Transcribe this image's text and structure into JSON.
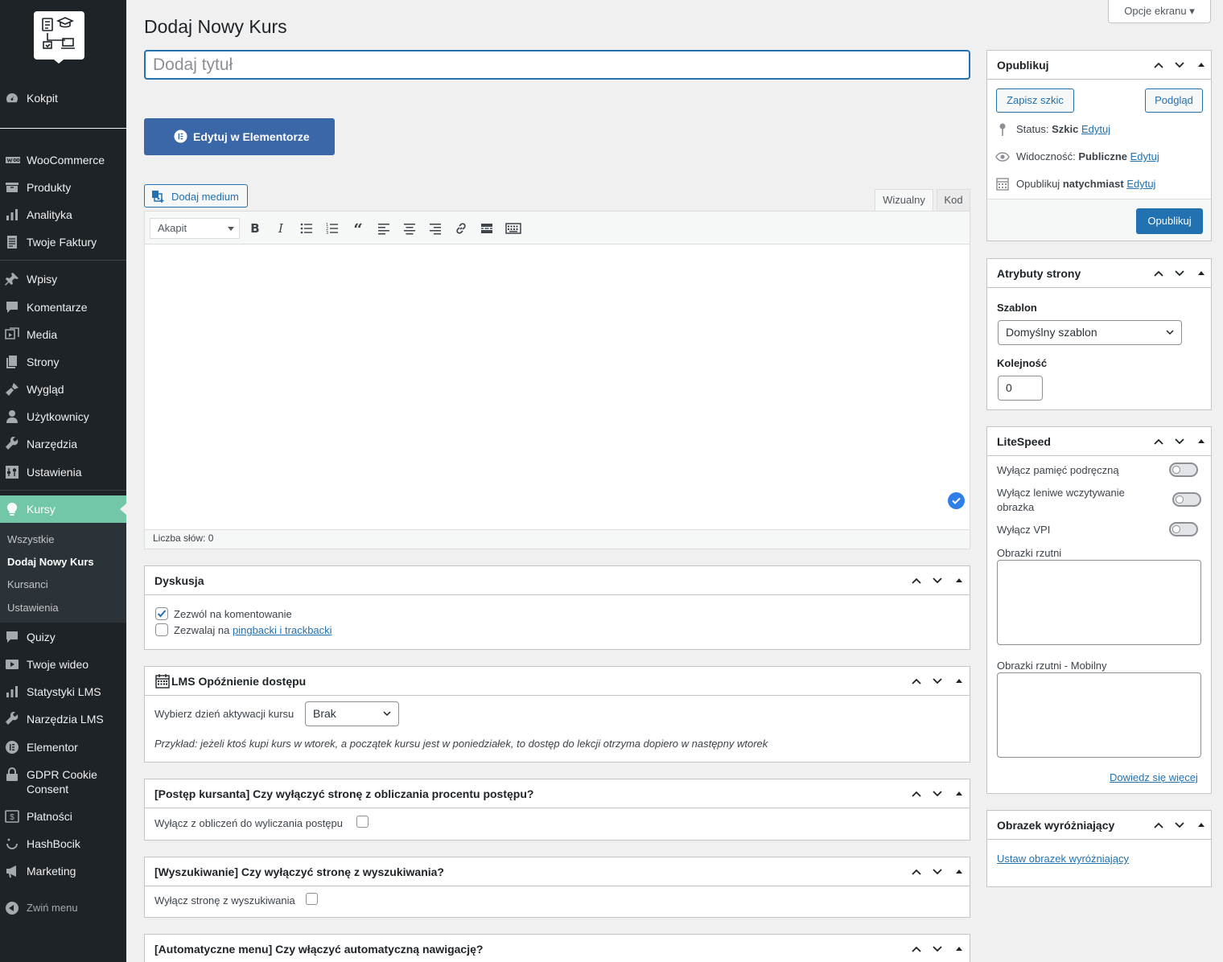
{
  "app": {
    "page_title": "Dodaj Nowy Kurs",
    "screen_options": "Opcje ekranu ▾",
    "title_placeholder": "Dodaj tytuł"
  },
  "sidebar": {
    "items": [
      {
        "label": "Kokpit",
        "icon": "dashboard-icon"
      },
      {
        "label": "WooCommerce",
        "icon": "woocommerce-icon"
      },
      {
        "label": "Produkty",
        "icon": "products-icon"
      },
      {
        "label": "Analityka",
        "icon": "analytics-icon"
      },
      {
        "label": "Twoje Faktury",
        "icon": "invoices-icon"
      },
      {
        "label": "Wpisy",
        "icon": "pin-icon"
      },
      {
        "label": "Komentarze",
        "icon": "comments-icon"
      },
      {
        "label": "Media",
        "icon": "media-icon"
      },
      {
        "label": "Strony",
        "icon": "pages-icon"
      },
      {
        "label": "Wygląd",
        "icon": "appearance-icon"
      },
      {
        "label": "Użytkownicy",
        "icon": "users-icon"
      },
      {
        "label": "Narzędzia",
        "icon": "tools-icon"
      },
      {
        "label": "Ustawienia",
        "icon": "settings-icon"
      }
    ],
    "active": {
      "label": "Kursy",
      "icon": "lightbulb-icon"
    },
    "submenu": [
      "Wszystkie",
      "Dodaj Nowy Kurs",
      "Kursanci",
      "Ustawienia"
    ],
    "items_after": [
      {
        "label": "Quizy",
        "icon": "quiz-icon"
      },
      {
        "label": "Twoje wideo",
        "icon": "video-icon"
      },
      {
        "label": "Statystyki LMS",
        "icon": "stats-icon"
      },
      {
        "label": "Narzędzia LMS",
        "icon": "lms-tools-icon"
      },
      {
        "label": "Elementor",
        "icon": "elementor-icon"
      },
      {
        "label": "GDPR Cookie",
        "label2": "Consent",
        "icon": "lock-icon"
      },
      {
        "label": "Płatności",
        "icon": "payments-icon"
      },
      {
        "label": "HashBocik",
        "icon": "hashbocik-icon"
      },
      {
        "label": "Marketing",
        "icon": "marketing-icon"
      }
    ],
    "collapse": "Zwiń menu"
  },
  "editor": {
    "elementor_btn": "Edytuj w Elementorze",
    "add_media": "Dodaj medium",
    "tab_visual": "Wizualny",
    "tab_code": "Kod",
    "format": "Akapit",
    "word_count": "Liczba słów: 0"
  },
  "discussion": {
    "title": "Dyskusja",
    "allow_comments": "Zezwól na komentowanie",
    "allow_pings_prefix": "Zezwalaj na ",
    "allow_pings_link": "pingbacki i trackbacki",
    "comments_checked": true,
    "pings_checked": false
  },
  "lms_delay": {
    "title": "LMS Opóźnienie dostępu",
    "label": "Wybierz dzień aktywacji kursu",
    "value": "Brak",
    "example": "Przykład: jeżeli ktoś kupi kurs w wtorek, a początek kursu jest w poniedziałek, to dostęp do lekcji otrzyma dopiero w następny wtorek"
  },
  "progress": {
    "title": "[Postęp kursanta] Czy wyłączyć stronę z obliczania procentu postępu?",
    "label": "Wyłącz z obliczeń do wyliczania postępu"
  },
  "search": {
    "title": "[Wyszukiwanie] Czy wyłączyć stronę z wyszukiwania?",
    "label": "Wyłącz stronę z wyszukiwania"
  },
  "automenu": {
    "title": "[Automatyczne menu] Czy włączyć automatyczną nawigację?"
  },
  "publish": {
    "title": "Opublikuj",
    "save_draft": "Zapisz szkic",
    "preview": "Podgląd",
    "status_label": "Status: ",
    "status_value": "Szkic",
    "visibility_label": "Widoczność: ",
    "visibility_value": "Publiczne",
    "publish_label": "Opublikuj ",
    "publish_value": "natychmiast",
    "edit": "Edytuj",
    "publish_btn": "Opublikuj"
  },
  "attributes": {
    "title": "Atrybuty strony",
    "template_label": "Szablon",
    "template_value": "Domyślny szablon",
    "order_label": "Kolejność",
    "order_value": "0"
  },
  "litespeed": {
    "title": "LiteSpeed",
    "opt1": "Wyłącz pamięć podręczną",
    "opt2a": "Wyłącz leniwe wczytywanie",
    "opt2b": "obrazka",
    "opt3": "Wyłącz VPI",
    "ta1": "Obrazki rzutni",
    "ta2": "Obrazki rzutni - Mobilny",
    "learn_more": "Dowiedz się więcej"
  },
  "featured": {
    "title": "Obrazek wyróżniający",
    "set_link": "Ustaw obrazek wyróżniający"
  },
  "colors": {
    "accent": "#2271b1",
    "sidebar": "#1d2327",
    "active": "#72c7a8",
    "elementor": "#3a67a8"
  }
}
